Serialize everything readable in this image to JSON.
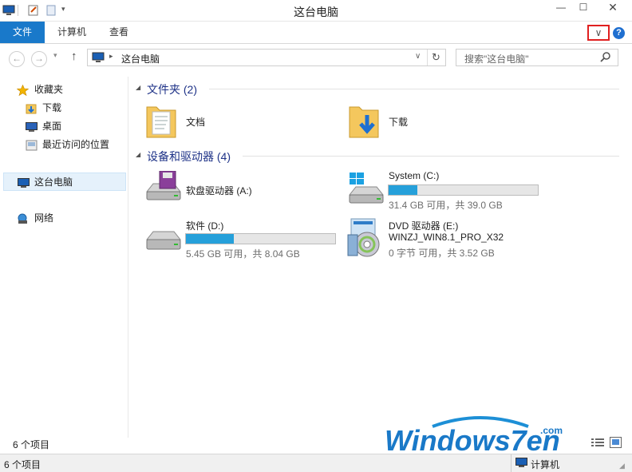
{
  "window": {
    "title": "这台电脑"
  },
  "ribbon": {
    "tabs": [
      "文件",
      "计算机",
      "查看"
    ],
    "expand_glyph": "∨",
    "help_glyph": "?"
  },
  "address": {
    "path": "这台电脑",
    "search_placeholder": "搜索\"这台电脑\""
  },
  "navpane": {
    "favorites_label": "收藏夹",
    "favorites": [
      "下载",
      "桌面",
      "最近访问的位置"
    ],
    "this_pc": "这台电脑",
    "network": "网络"
  },
  "content": {
    "folders_header": "文件夹 (2)",
    "folders": [
      {
        "name": "文档"
      },
      {
        "name": "下载"
      }
    ],
    "devices_header": "设备和驱动器 (4)",
    "drives": [
      {
        "name": "软盘驱动器 (A:)"
      },
      {
        "name": "System (C:)",
        "usage": "31.4 GB 可用，共 39.0 GB",
        "used_fraction": 0.19
      },
      {
        "name": "软件 (D:)",
        "usage": "5.45 GB 可用，共 8.04 GB",
        "used_fraction": 0.32
      },
      {
        "name": "DVD 驱动器 (E:)",
        "volume": "WINZJ_WIN8.1_PRO_X32",
        "usage": "0 字节 可用，共 3.52 GB"
      }
    ]
  },
  "status": {
    "count": "6 个项目",
    "bottom_count": "6 个项目",
    "bottom_location": "计算机"
  },
  "watermark": {
    "text": "Windows7en",
    "suffix": ".com"
  },
  "colors": {
    "accent": "#1979ca",
    "progress": "#26a0da",
    "highlight_box": "#e02020"
  }
}
